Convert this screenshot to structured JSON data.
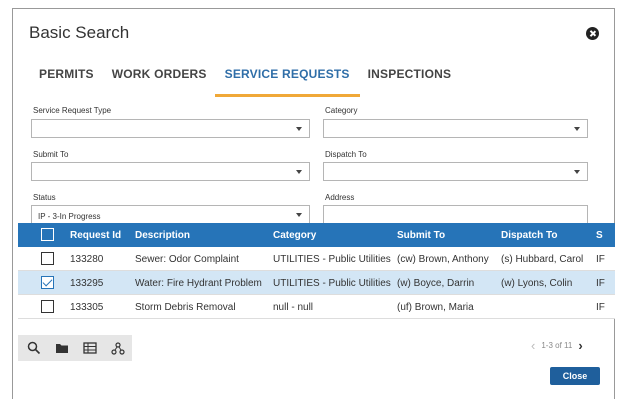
{
  "dialog": {
    "title": "Basic Search"
  },
  "tabs": [
    {
      "label": "PERMITS",
      "active": false
    },
    {
      "label": "WORK ORDERS",
      "active": false
    },
    {
      "label": "SERVICE REQUESTS",
      "active": true
    },
    {
      "label": "INSPECTIONS",
      "active": false
    }
  ],
  "filters": {
    "service_request_type": {
      "label": "Service Request Type",
      "value": ""
    },
    "category": {
      "label": "Category",
      "value": ""
    },
    "submit_to": {
      "label": "Submit To",
      "value": ""
    },
    "dispatch_to": {
      "label": "Dispatch To",
      "value": ""
    },
    "status": {
      "label": "Status",
      "value": "IP - 3-In Progress"
    },
    "address": {
      "label": "Address",
      "value": ""
    }
  },
  "table": {
    "columns": [
      "Request Id",
      "Description",
      "Category",
      "Submit To",
      "Dispatch To",
      "S"
    ],
    "rows": [
      {
        "checked": false,
        "selected": false,
        "id": "133280",
        "description": "Sewer: Odor Complaint",
        "category": "UTILITIES - Public Utilities",
        "submit_to": "(cw) Brown, Anthony",
        "dispatch_to": "(s) Hubbard, Carol",
        "status": "IF"
      },
      {
        "checked": true,
        "selected": true,
        "id": "133295",
        "description": "Water: Fire Hydrant Problem",
        "category": "UTILITIES - Public Utilities",
        "submit_to": "(w) Boyce, Darrin",
        "dispatch_to": "(w) Lyons, Colin",
        "status": "IF"
      },
      {
        "checked": false,
        "selected": false,
        "id": "133305",
        "description": "Storm Debris Removal",
        "category": "null - null",
        "submit_to": "(uf) Brown, Maria",
        "dispatch_to": "",
        "status": "IF"
      }
    ]
  },
  "pager": {
    "text": "1-3 of 11"
  },
  "footer": {
    "close_label": "Close"
  },
  "colors": {
    "header_blue": "#2674b8",
    "selected_row": "#d3e6f5",
    "tab_underline": "#f0a838",
    "active_tab_text": "#2f6ea8",
    "close_button": "#1f5f9c"
  }
}
